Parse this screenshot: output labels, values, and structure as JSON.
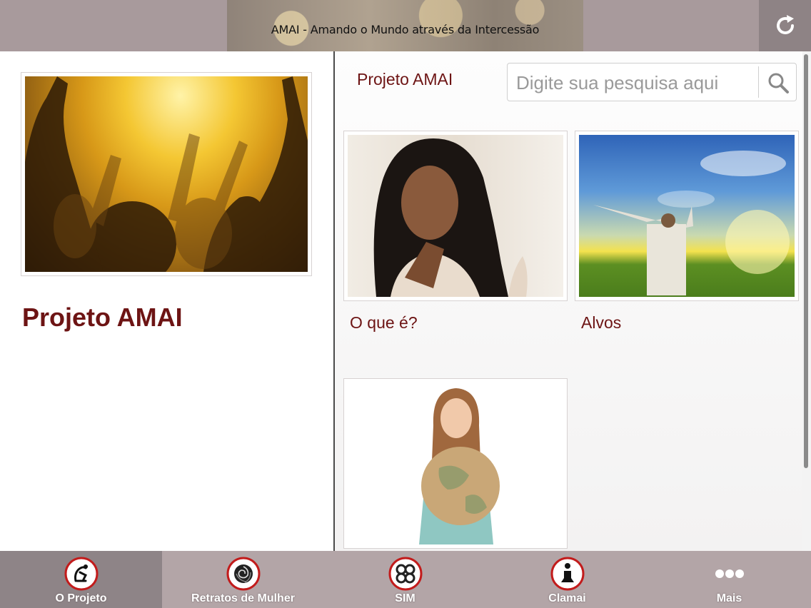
{
  "header": {
    "title": "AMAI - Amando o Mundo através da Intercessão",
    "refresh_icon": "refresh-icon"
  },
  "left": {
    "title": "Projeto AMAI"
  },
  "right": {
    "heading": "Projeto AMAI",
    "search": {
      "placeholder": "Digite sua pesquisa aqui",
      "value": ""
    },
    "cards": [
      {
        "label": "O que é?"
      },
      {
        "label": "Alvos"
      },
      {
        "label": ""
      }
    ]
  },
  "tabs": [
    {
      "label": "O Projeto",
      "icon": "kneeling-figure-icon",
      "active": true
    },
    {
      "label": "Retratos de Mulher",
      "icon": "rose-icon",
      "active": false
    },
    {
      "label": "SIM",
      "icon": "knot-icon",
      "active": false
    },
    {
      "label": "Clamai",
      "icon": "praying-figure-icon",
      "active": false
    },
    {
      "label": "Mais",
      "icon": "more-dots-icon",
      "active": false
    }
  ],
  "colors": {
    "accent": "#6d1414",
    "topbar": "#a89a9c",
    "tabbar": "#b3a5a7",
    "tab_active": "#8e8487"
  }
}
